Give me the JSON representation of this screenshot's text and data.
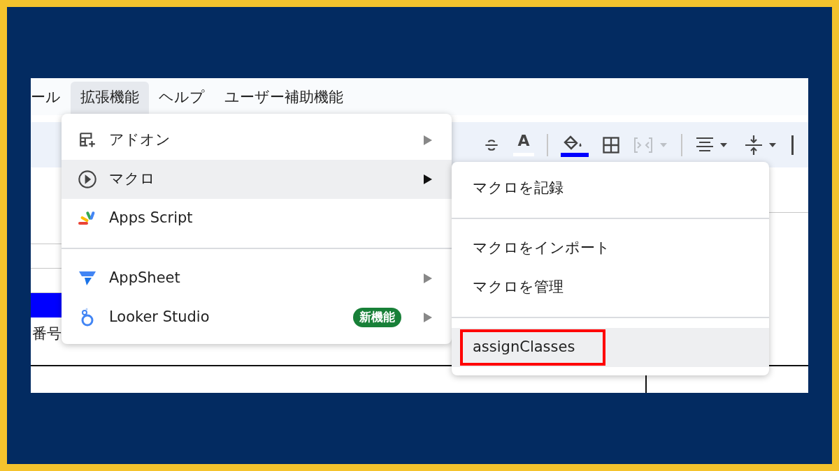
{
  "menubar": [
    {
      "label": "ール",
      "selected": false
    },
    {
      "label": "拡張機能",
      "selected": true
    },
    {
      "label": "ヘルプ",
      "selected": false
    },
    {
      "label": "ユーザー補助機能",
      "selected": false
    }
  ],
  "toolbar": [
    {
      "kind": "strikethrough",
      "disabled": false
    },
    {
      "kind": "text-color",
      "label": "A",
      "disabled": false
    },
    {
      "kind": "fill-color",
      "disabled": false
    },
    {
      "kind": "borders",
      "disabled": false
    },
    {
      "kind": "merge",
      "disabled": true
    },
    {
      "kind": "align",
      "disabled": false
    },
    {
      "kind": "valign",
      "disabled": false
    }
  ],
  "sheet": {
    "cell_text": "番号"
  },
  "menu": {
    "items": [
      {
        "kind": "addon",
        "label": "アドオン",
        "selected": false,
        "has_submenu": true
      },
      {
        "kind": "macro",
        "label": "マクロ",
        "selected": true,
        "has_submenu": true
      },
      {
        "kind": "apps-script",
        "label": "Apps Script",
        "selected": false,
        "has_submenu": false
      },
      {
        "kind": "divider"
      },
      {
        "kind": "appsheet",
        "label": "AppSheet",
        "selected": false,
        "has_submenu": true
      },
      {
        "kind": "looker",
        "label": "Looker Studio",
        "badge": "新機能",
        "selected": false,
        "has_submenu": true
      }
    ]
  },
  "submenu": {
    "items": [
      {
        "kind": "item",
        "label": "マクロを記録",
        "selected": false
      },
      {
        "kind": "divider"
      },
      {
        "kind": "item",
        "label": "マクロをインポート",
        "selected": false
      },
      {
        "kind": "item",
        "label": "マクロを管理",
        "selected": false
      },
      {
        "kind": "divider"
      },
      {
        "kind": "item",
        "label": "assignClasses",
        "selected": true,
        "highlighted": true
      }
    ]
  }
}
